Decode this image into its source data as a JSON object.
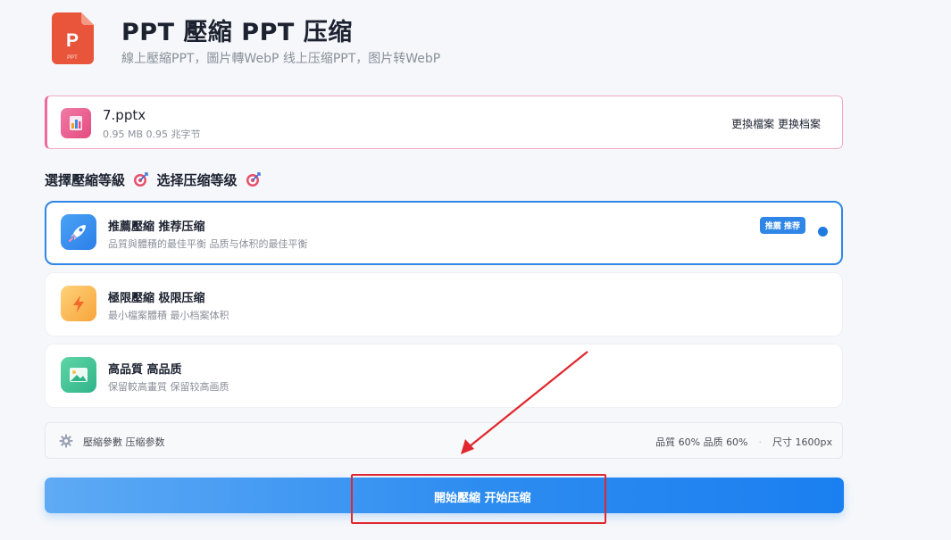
{
  "header": {
    "title": "PPT 壓縮 PPT 压缩",
    "subtitle": "線上壓縮PPT，圖片轉WebP 线上压缩PPT，图片转WebP",
    "app_icon_letter": "P",
    "app_icon_tag": "PPT",
    "app_icon_color": "#e8553a"
  },
  "file": {
    "name": "7.pptx",
    "size": "0.95 MB 0.95 兆字节",
    "replace_label": "更換檔案 更换档案",
    "accent_color": "#ef6a98"
  },
  "section": {
    "title": "選擇壓縮等級",
    "title_alt": "选择压缩等级",
    "icon": "target-icon"
  },
  "options": [
    {
      "name": "推薦壓縮 推荐压缩",
      "desc": "品質與體積的最佳平衡 品质与体积的最佳平衡",
      "badge": "推薦 推荐",
      "icon": "rocket-icon",
      "selected": true
    },
    {
      "name": "極限壓縮 极限压缩",
      "desc": "最小檔案體積 最小档案体积",
      "icon": "lightning-icon",
      "selected": false
    },
    {
      "name": "高品質 高品质",
      "desc": "保留較高畫質 保留较高画质",
      "icon": "image-icon",
      "selected": false
    }
  ],
  "params": {
    "label": "壓縮參數 压缩参数",
    "quality": "品質 60% 品质 60%",
    "size": "尺寸 1600px",
    "icon": "gear-icon"
  },
  "action": {
    "start_label": "開始壓縮 开始压缩",
    "color": "#2d8cf0"
  },
  "annotation": {
    "color": "#e0282e"
  }
}
